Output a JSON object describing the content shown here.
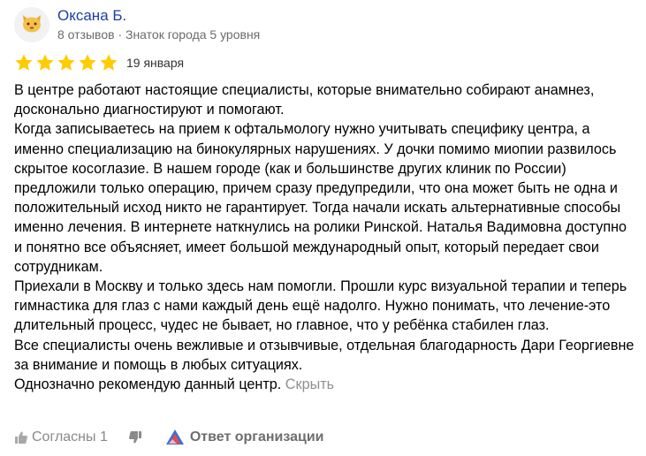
{
  "author": {
    "name": "Оксана Б.",
    "meta": "8 отзывов · Знаток города 5 уровня",
    "avatar_icon": "cat-face-icon"
  },
  "review": {
    "rating": 5,
    "rating_max": 5,
    "star_color": "#ffcc00",
    "date": "19 января",
    "paragraphs": [
      "В центре работают настоящие специалисты, которые внимательно собирают анамнез, досконально диагностируют и помогают.",
      "Когда записываетесь на прием к офтальмологу нужно учитывать специфику центра, а именно специализацию на бинокулярных нарушениях. У дочки помимо миопии развилось скрытое косоглазие. В нашем городе (как и большинстве других клиник по России) предложили только операцию, причем сразу предупредили, что она может быть не одна и положительный исход никто не гарантирует. Тогда начали искать альтернативные способы именно лечения. В интернете наткнулись на ролики Ринской. Наталья Вадимовна доступно и понятно все объясняет, имеет большой международный опыт, который передает свои сотрудникам.",
      "Приехали в Москву и только здесь нам помогли. Прошли курс визуальной терапии и теперь гимнастика для глаз с нами каждый день ещё надолго. Нужно понимать, что лечение-это длительный процесс, чудес не бывает, но главное, что у ребёнка стабилен глаз.",
      "Все специалисты очень вежливые и отзывчивые, отдельная благодарность Дари Георгиевне за внимание и помощь в любых ситуациях.",
      "Однозначно рекомендую данный центр."
    ],
    "collapse_label": "Скрыть"
  },
  "actions": {
    "like_label": "Согласны 1",
    "like_icon": "thumbs-up-icon",
    "dislike_icon": "thumbs-down-icon",
    "org_reply_label": "Ответ организации",
    "org_reply_icon": "organization-logo-icon"
  }
}
